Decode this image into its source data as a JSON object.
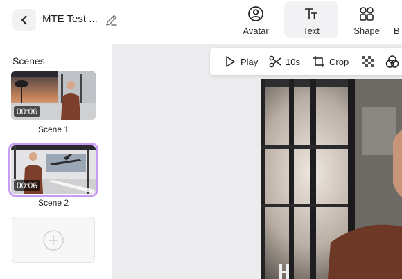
{
  "header": {
    "back_label": "",
    "project_title": "MTE Test ...",
    "tools": [
      {
        "label": "Avatar",
        "icon": "avatar-icon"
      },
      {
        "label": "Text",
        "icon": "text-icon"
      },
      {
        "label": "Shape",
        "icon": "shape-icon"
      },
      {
        "label": "B",
        "icon": ""
      }
    ]
  },
  "sidebar": {
    "title": "Scenes",
    "scenes": [
      {
        "name": "Scene 1",
        "duration": "00:06",
        "selected": false
      },
      {
        "name": "Scene 2",
        "duration": "00:06",
        "selected": true
      }
    ],
    "add_icon": "plus-circle-icon"
  },
  "canvas_toolbar": {
    "play_label": "Play",
    "split_label": "10s",
    "crop_label": "Crop"
  },
  "colors": {
    "selected_outline": "#c89cf2",
    "canvas_bg": "#ececee",
    "active_tool_bg": "#f2f2f4"
  }
}
